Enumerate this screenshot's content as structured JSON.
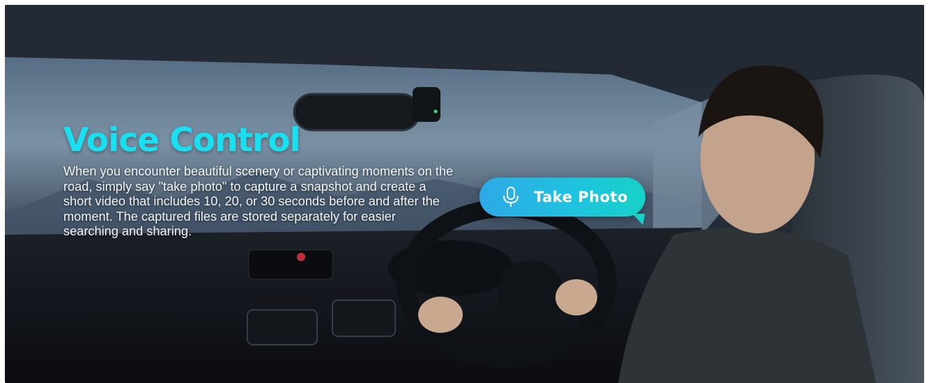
{
  "hero": {
    "title": "Voice Control",
    "description": "When you encounter beautiful scenery or captivating moments on the road, simply say \"take photo\" to capture a snapshot and create a short video that includes 10, 20, or 30 seconds before and after the moment. The captured files are stored separately for easier searching and sharing.",
    "title_color": "#19e0f0"
  },
  "voice_bubble": {
    "label": "Take Photo",
    "icon": "microphone-icon",
    "gradient_start": "#2ea9e6",
    "gradient_end": "#16d2c8"
  }
}
